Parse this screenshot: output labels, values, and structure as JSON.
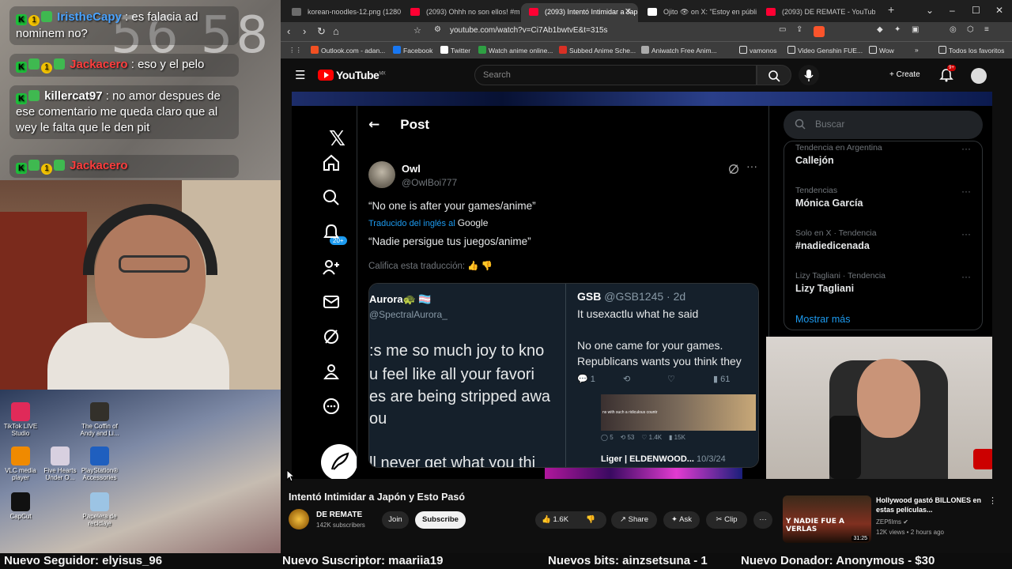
{
  "stream_overlay": {
    "clock": "56 58",
    "chat": [
      {
        "user": "IristheCapy",
        "text": ": es falacia ad nominem no?"
      },
      {
        "user": "Jackacero",
        "text": ": eso y el pelo"
      },
      {
        "user": "killercat97",
        "text": ": no amor despues de ese comentario me queda claro que al wey le falta que le den pit"
      },
      {
        "user": "Jackacero",
        "text": ""
      }
    ],
    "desktop_icons": [
      {
        "label": "TikTok LIVE Studio"
      },
      {
        "label": "The Coffin of Andy and Li..."
      },
      {
        "label": "VLC media player"
      },
      {
        "label": "Five Hearts Under O..."
      },
      {
        "label": "PlayStation® Accessories"
      },
      {
        "label": "CapCut"
      },
      {
        "label": "Papelera de reciclaje"
      }
    ]
  },
  "browser": {
    "tabs": [
      {
        "label": "korean-noodles-12.png (1280×1...",
        "color": "#6c6c6c"
      },
      {
        "label": "(2093) Ohhh no son ellos! #meme",
        "color": "#ff0033"
      },
      {
        "label": "(2093) Intentó Intimidar a Jap",
        "color": "#ff0033"
      },
      {
        "label": "Ojito 👁 on X: \"Estoy en público",
        "color": "#ffffff"
      },
      {
        "label": "(2093) DE REMATE - YouTube",
        "color": "#ff0033"
      }
    ],
    "new_tab": "+",
    "url": "youtube.com/watch?v=Ci7Ab1bwtvE&t=315s",
    "bookmarks": [
      {
        "label": "Outlook.com - adan...",
        "color": "#f25022"
      },
      {
        "label": "Facebook",
        "color": "#1877f2"
      },
      {
        "label": "Twitter",
        "color": "#ffffff"
      },
      {
        "label": "Watch anime online...",
        "color": "#2ea043"
      },
      {
        "label": "Subbed Anime Sche...",
        "color": "#d93025"
      },
      {
        "label": "Aniwatch Free Anim...",
        "color": "#aaaaaa"
      },
      {
        "label": "vamonos",
        "color": "#e0e0e0"
      },
      {
        "label": "Video Genshin FUE...",
        "color": "#e0e0e0"
      },
      {
        "label": "Wow",
        "color": "#e0e0e0"
      }
    ],
    "all_bookmarks": "Todos los favoritos"
  },
  "youtube": {
    "logo": "YouTube",
    "region": "MX",
    "search_placeholder": "Search",
    "create_label": "Create",
    "notif_count": "9+",
    "video_title": "Intentó Intimidar a Japón y Esto Pasó",
    "channel_name": "DE REMATE",
    "channel_subs": "142K subscribers",
    "join_label": "Join",
    "subscribe_label": "Subscribe",
    "likes": "1.6K",
    "share_label": "Share",
    "ask_label": "Ask",
    "clip_label": "Clip",
    "recommended": {
      "thumb_caption": "Y NADIE FUE A VERLAS",
      "duration": "31:25",
      "title": "Hollywood gastó BILLONES en estas películas...",
      "channel": "ZEPfilms",
      "meta": "12K views • 2 hours ago"
    }
  },
  "x_screen": {
    "header": "Post",
    "notif_badge": "20+",
    "author_name": "Owl",
    "author_handle": "@OwlBoi777",
    "tweet_text": "“No one is after your games/anime”",
    "translated_from": "Traducido del inglés al",
    "translator": "Google",
    "translated_text": "“Nadie persigue tus juegos/anime”",
    "rate_translation": "Califica esta traducción:",
    "quote_left": {
      "name": "Aurora🐢 🏳️‍⚧️",
      "handle": "@SpectralAurora_",
      "lines": [
        ":s me so much joy to kno",
        "u feel like all your favori",
        "es are being stripped awa",
        "ou",
        "ll never get what you thi"
      ]
    },
    "quote_right": {
      "name": "GSB",
      "handle": "@GSB1245 · 2d",
      "line1": "It usexactlu what he said",
      "line2": "No one came for your games.",
      "line3": "Republicans wants you think they",
      "replies": "1",
      "views": "61",
      "stats2": [
        "5",
        "53",
        "1.4K",
        "15K"
      ],
      "thumb_caption": "ns with such a ridiculous countr",
      "reply_author": "Liger | ELDENWOOD...",
      "reply_date": "10/3/24"
    },
    "search_placeholder": "Buscar",
    "trends": [
      {
        "category": "Tendencia en Argentina",
        "name": "Callejón"
      },
      {
        "category": "Tendencias",
        "name": "Mónica García"
      },
      {
        "category": "Solo en X · Tendencia",
        "name": "#nadiedicenada"
      },
      {
        "category": "Lizy Tagliani · Tendencia",
        "name": "Lizy Tagliani"
      }
    ],
    "show_more": "Mostrar más"
  },
  "ticker": {
    "follower": "Nuevo Seguidor: elyisus_96",
    "subscriber": "Nuevo Suscriptor: maariia19",
    "bits": "Nuevos bits: ainzsetsuna - 1",
    "donor": "Nuevo Donador: Anonymous - $30"
  },
  "colors": {
    "x_blue": "#1d9bf0",
    "yt_red": "#ff0000",
    "twitch_green": "#1dbf3a",
    "chat_name_blue": "#4aa3ff",
    "chat_name_red": "#ff3d3d"
  }
}
